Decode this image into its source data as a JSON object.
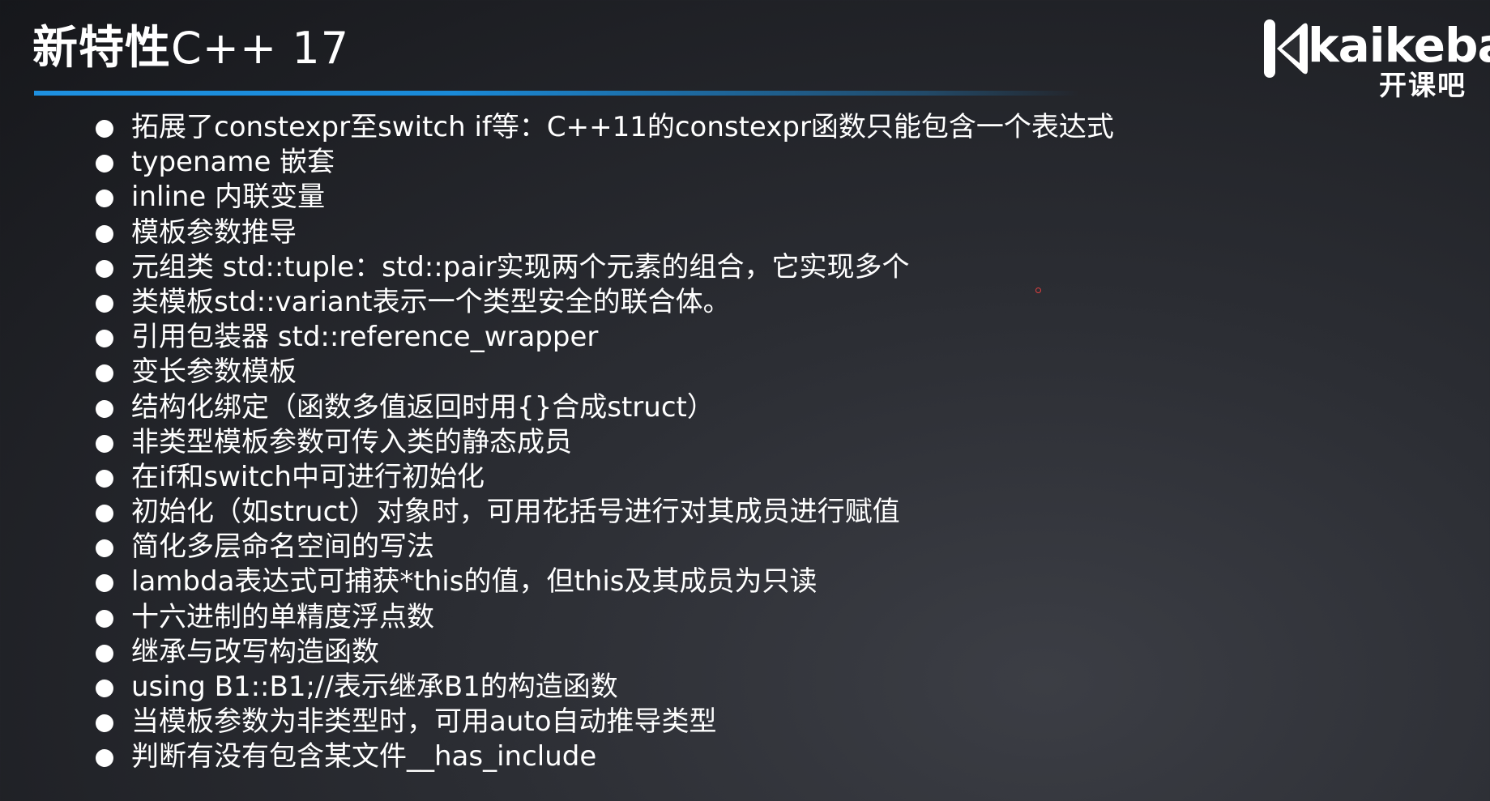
{
  "title": {
    "main": "新特性",
    "sub": "C++ 17"
  },
  "logo": {
    "wordmark": "kaikeba",
    "cn": "开课吧",
    "icon": "kaikeba-k-icon"
  },
  "features": [
    "拓展了constexpr至switch if等：C++11的constexpr函数只能包含一个表达式",
    "typename 嵌套",
    "inline 内联变量",
    "模板参数推导",
    "元组类 std::tuple：std::pair实现两个元素的组合，它实现多个",
    "类模板std::variant表示一个类型安全的联合体。",
    "引用包装器 std::reference_wrapper",
    "变长参数模板",
    "结构化绑定（函数多值返回时用{}合成struct）",
    "非类型模板参数可传入类的静态成员",
    "在if和switch中可进行初始化",
    "初始化（如struct）对象时，可用花括号进行对其成员进行赋值",
    "简化多层命名空间的写法",
    "lambda表达式可捕获*this的值，但this及其成员为只读",
    "十六进制的单精度浮点数",
    "继承与改写构造函数",
    "using B1::B1;//表示继承B1的构造函数",
    "当模板参数为非类型时，可用auto自动推导类型",
    "判断有没有包含某文件__has_include"
  ],
  "colors": {
    "accent": "#1e90e0",
    "text": "#ffffff",
    "background": "#2b2d33"
  }
}
